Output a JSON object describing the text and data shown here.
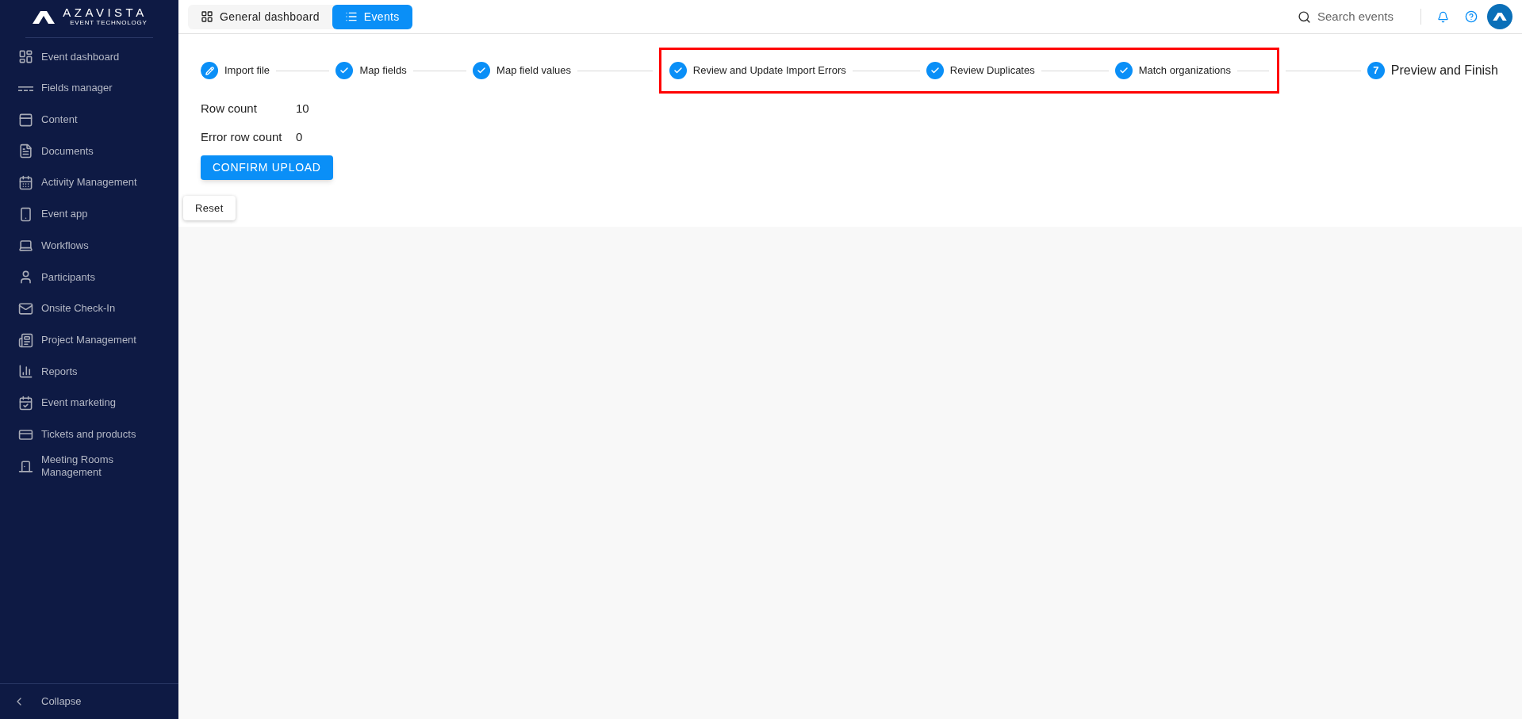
{
  "brand": {
    "name": "AZAVISTA",
    "tagline": "EVENT TECHNOLOGY"
  },
  "sidebar": {
    "items": [
      {
        "label": "Event dashboard",
        "selected": false
      },
      {
        "label": "Fields manager",
        "selected": false
      },
      {
        "label": "Content",
        "selected": false
      },
      {
        "label": "Documents",
        "selected": false
      },
      {
        "label": "Activity Management",
        "selected": false
      },
      {
        "label": "Event app",
        "selected": false
      },
      {
        "label": "Workflows",
        "selected": false
      },
      {
        "label": "Participants",
        "selected": false
      },
      {
        "label": "Onsite Check-In",
        "selected": false
      },
      {
        "label": "Project Management",
        "selected": false
      },
      {
        "label": "Reports",
        "selected": false
      },
      {
        "label": "Event marketing",
        "selected": false
      },
      {
        "label": "Tickets and products",
        "selected": false
      },
      {
        "label": "Meeting Rooms Management",
        "selected": false
      }
    ],
    "collapse": "Collapse"
  },
  "top_tabs": [
    {
      "label": "General dashboard",
      "selected": false
    },
    {
      "label": "Events",
      "selected": true
    }
  ],
  "search": {
    "placeholder": "Search events"
  },
  "stepper": [
    {
      "label": "Import file",
      "kind": "edit",
      "highlighted": false
    },
    {
      "label": "Map fields",
      "kind": "done",
      "highlighted": false
    },
    {
      "label": "Map field values",
      "kind": "done",
      "highlighted": false
    },
    {
      "label": "Review and Update Import Errors",
      "kind": "done",
      "highlighted": true
    },
    {
      "label": "Review Duplicates",
      "kind": "done",
      "highlighted": true
    },
    {
      "label": "Match organizations",
      "kind": "done",
      "highlighted": true
    },
    {
      "label": "Preview and Finish",
      "kind": "current",
      "number": "7",
      "highlighted": false
    }
  ],
  "summary": [
    {
      "label": "Row count",
      "value": "10"
    },
    {
      "label": "Error row count",
      "value": "0"
    }
  ],
  "confirm_button": "CONFIRM UPLOAD",
  "reset_button": "Reset"
}
